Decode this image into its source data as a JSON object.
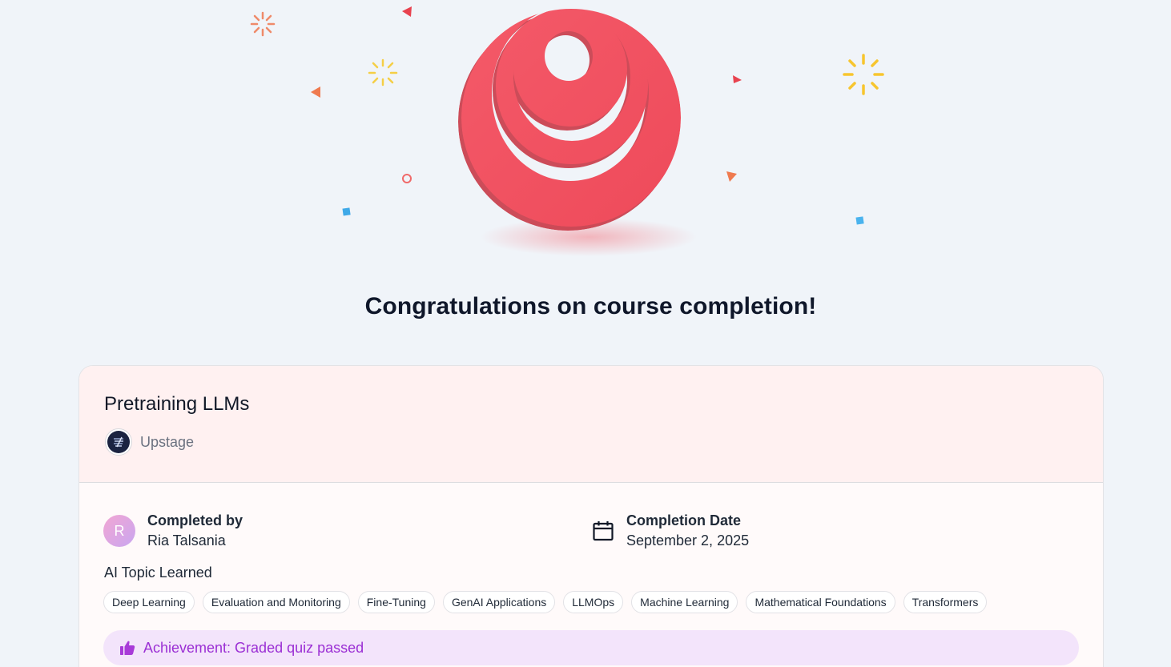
{
  "headline": "Congratulations on course completion!",
  "course": {
    "title": "Pretraining LLMs",
    "provider": "Upstage"
  },
  "completed_by": {
    "label": "Completed by",
    "name": "Ria Talsania",
    "avatar_initial": "R"
  },
  "completion_date": {
    "label": "Completion Date",
    "value": "September 2, 2025"
  },
  "topics": {
    "label": "AI Topic Learned",
    "items": [
      "Deep Learning",
      "Evaluation and Monitoring",
      "Fine-Tuning",
      "GenAI Applications",
      "LLMOps",
      "Machine Learning",
      "Mathematical Foundations",
      "Transformers"
    ]
  },
  "achievement": {
    "text": "Achievement: Graded quiz passed"
  },
  "icons": {
    "trophy": "concentric-rings-illustration",
    "calendar": "calendar-icon",
    "thumb": "thumbs-up-icon",
    "provider": "upstage-logo"
  },
  "colors": {
    "page_bg": "#f0f4f9",
    "ring": "#f25060",
    "achievement_bg": "#f3e4fb",
    "achievement_text": "#9b2fd4",
    "card_top_bg": "#fff1f1"
  }
}
